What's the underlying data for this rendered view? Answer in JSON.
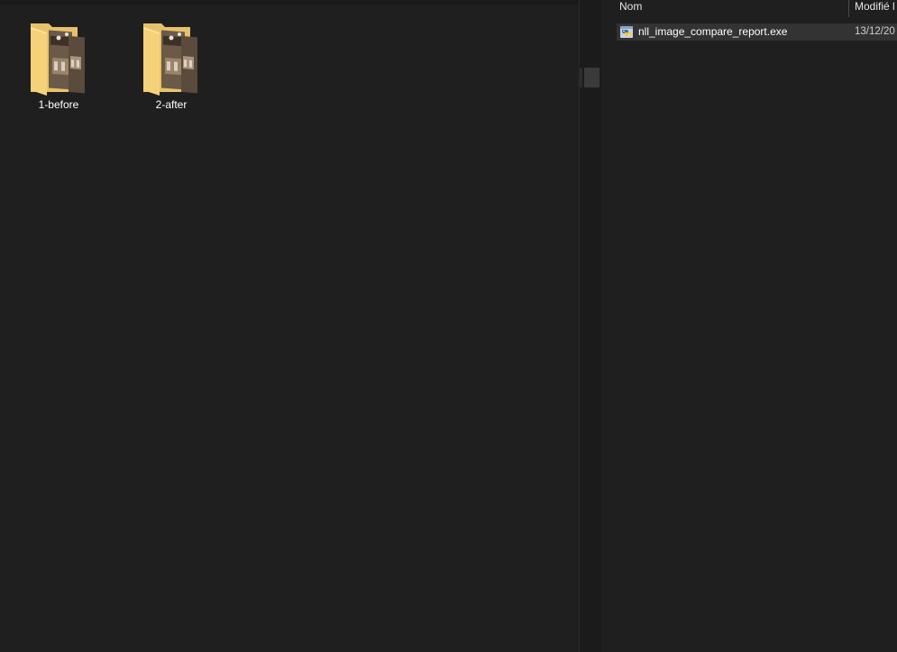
{
  "left_pane": {
    "folders": [
      {
        "label": "1-before",
        "icon": "folder-with-images-icon"
      },
      {
        "label": "2-after",
        "icon": "folder-with-images-icon"
      }
    ]
  },
  "right_pane": {
    "columns": {
      "name": "Nom",
      "modified": "Modifié l"
    },
    "files": [
      {
        "name": "nll_image_compare_report.exe",
        "modified": "13/12/20",
        "icon": "python-exe-icon"
      }
    ]
  },
  "colors": {
    "background": "#1f1f1f",
    "selected_row": "#333333",
    "folder_yellow": "#f5d27a"
  }
}
